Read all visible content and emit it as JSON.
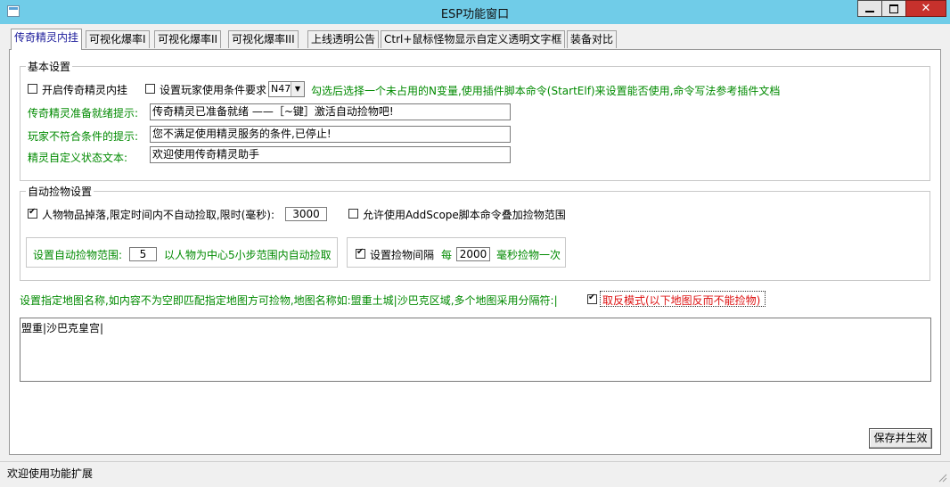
{
  "window": {
    "title": "ESP功能窗口",
    "close_glyph": "✕"
  },
  "tabs": [
    {
      "label": "传奇精灵内挂",
      "active": true
    },
    {
      "label": "可视化爆率I"
    },
    {
      "label": "可视化爆率II"
    },
    {
      "label": "可视化爆率III"
    },
    {
      "label": "上线透明公告"
    },
    {
      "label": "Ctrl+鼠标怪物显示自定义透明文字框"
    },
    {
      "label": "装备对比"
    }
  ],
  "basic": {
    "group_title": "基本设置",
    "enable_label": "开启传奇精灵内挂",
    "enable_checked": false,
    "require_label": "设置玩家使用条件要求",
    "require_checked": false,
    "var_select": "N47",
    "hint": "勾选后选择一个未占用的N变量,使用插件脚本命令(StartElf)来设置能否使用,命令写法参考插件文档",
    "ready_label": "传奇精灵准备就绪提示:",
    "ready_value": "传奇精灵已准备就绪 ——［~键］激活自动捡物吧!",
    "notmet_label": "玩家不符合条件的提示:",
    "notmet_value": "您不满足使用精灵服务的条件,已停止!",
    "status_label": "精灵自定义状态文本:",
    "status_value": "欢迎使用传奇精灵助手"
  },
  "autopick": {
    "group_title": "自动捡物设置",
    "drop_label": "人物物品掉落,限定时间内不自动捡取,限时(毫秒):",
    "drop_checked": true,
    "drop_ms": "3000",
    "scope_label": "允许使用AddScope脚本命令叠加捡物范围",
    "scope_checked": false,
    "range_label": "设置自动捡物范围:",
    "range_value": "5",
    "range_hint": "以人物为中心5小步范围内自动捡取",
    "interval_label": "设置捡物间隔",
    "interval_checked": true,
    "every_label": "每",
    "interval_ms": "2000",
    "interval_suffix": "毫秒捡物一次"
  },
  "map": {
    "hint": "设置指定地图名称,如内容不为空即匹配指定地图方可捡物,地图名称如:盟重土城|沙巴克区域,多个地图采用分隔符:|",
    "invert_label": "取反模式(以下地图反而不能捡物)",
    "invert_checked": true,
    "map_text": "盟重|沙巴克皇宫|"
  },
  "save_button": "保存并生效",
  "status_text": "欢迎使用功能扩展",
  "colors": {
    "titlebar": "#70cce8",
    "label_green": "#008a00",
    "warning_red": "#dd1111",
    "close_red": "#c7312c"
  }
}
